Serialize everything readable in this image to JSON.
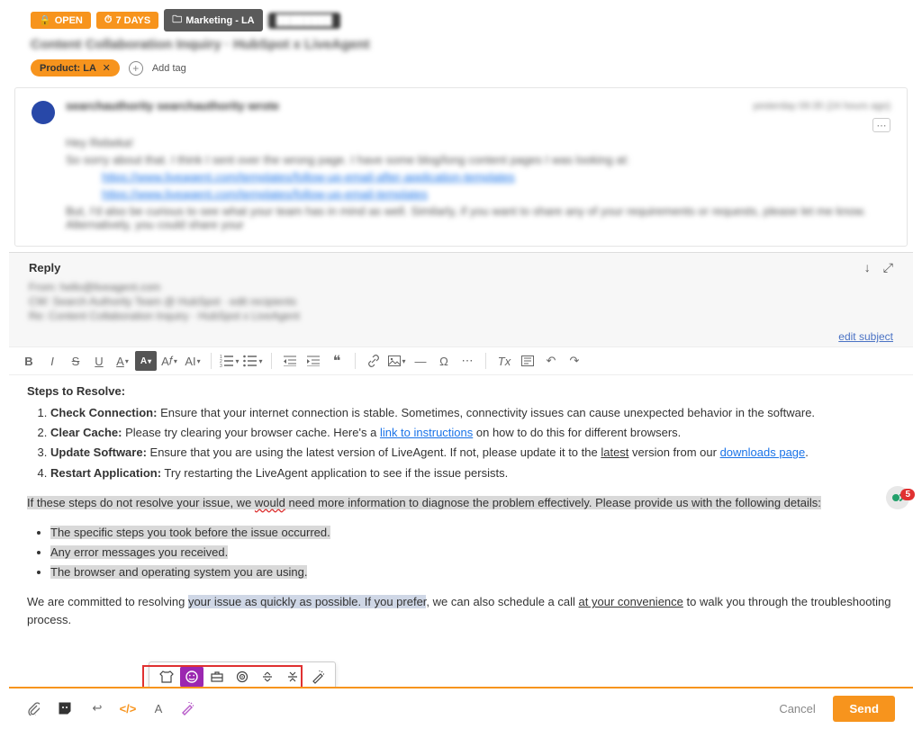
{
  "badges": {
    "open_icon": "lock",
    "open": "OPEN",
    "days_icon": "clock",
    "days": "7 DAYS",
    "folder_icon": "folder",
    "folder": "Marketing - LA",
    "hidden": "████████"
  },
  "ticket": {
    "subject_blur": "Content Collaboration Inquiry · HubSpot x LiveAgent",
    "tag_chip": "Product: LA",
    "tag_chip_remove": "✕",
    "add_tag": "Add tag"
  },
  "message": {
    "sender_blur": "searchauthority searchauthority wrote",
    "time_blur": "yesterday 09:35 (24 hours ago)",
    "greeting_blur": "Hey Rebeka!",
    "line1_blur": "So sorry about that. I think I sent over the wrong page. I have some blog/long content pages I was looking at:",
    "link1_blur": "https://www.liveagent.com/templates/follow-up-email-after-application-templates",
    "link2_blur": "https://www.liveagent.com/templates/follow-up-email-templates",
    "line2_blur": "But, I'd also be curious to see what your team has in mind as well. Similarly, if you want to share any of your requirements or requests, please let me know. Alternatively, you could share your"
  },
  "reply": {
    "title": "Reply",
    "from_blur": "From: hello@liveagent.com",
    "to_blur": "CW: Search Authority Team @ HubSpot · edit recipients",
    "subj_blur": "Re: Content Collaboration Inquiry · HubSpot x LiveAgent",
    "edit_subject": "edit subject"
  },
  "toolbar": {
    "bold": "B",
    "italic": "I",
    "strike": "S",
    "underline": "U",
    "a_caret": "A",
    "fill": "A",
    "font": "A",
    "size": "AI",
    "ol": "ol",
    "ul": "ul",
    "outdent": "⇤",
    "indent": "⇥",
    "quote": "❝",
    "link": "link",
    "image": "img",
    "hr": "—",
    "omega": "Ω",
    "more": "⋯",
    "tx": "Tx",
    "box": "☐",
    "undo": "↶",
    "redo": "↷"
  },
  "body": {
    "heading": "Steps to Resolve:",
    "s1a": "Check Connection:",
    "s1b": " Ensure that your internet connection is stable. Sometimes, connectivity issues can cause unexpected behavior in the software.",
    "s2a": "Clear Cache:",
    "s2b": " Please try clearing your browser cache. Here's a ",
    "s2link": "link to instructions",
    "s2c": " on how to do this for different browsers.",
    "s3a": "Update Software:",
    "s3b": " Ensure that you are using the latest version of LiveAgent. If not, please update it to the ",
    "s3u": "latest",
    "s3c": " version from our ",
    "s3link": "downloads page",
    "s3d": ".",
    "s4a": "Restart Application:",
    "s4b": " Try restarting the LiveAgent application to see if the issue persists.",
    "para1a": "If these steps do not resolve your issue, we ",
    "para1err": "would",
    "para1b": " need more information to diagnose the problem effectively. Please provide us with the following details:",
    "b1": "The specific steps you took before the issue occurred.",
    "b2": "Any error messages you received.",
    "b3": "The browser and operating system you are using.",
    "para2a": "We are committed to resolving ",
    "para2sel": "your issue as quickly as possible. If you prefer",
    "para2b": ", we can also schedule a call ",
    "para2u": "at your convenience",
    "para2c": " to walk you through the troubleshooting process."
  },
  "ai_popup": {
    "i1": "shirt",
    "i2": "smile",
    "i3": "briefcase",
    "i4": "target",
    "i5": "expand",
    "i6": "collapse",
    "i7": "wand"
  },
  "bottom_icons": {
    "attach": "paperclip",
    "note": "note",
    "reply": "reply-arrow",
    "code": "code",
    "a": "A",
    "wand": "wand"
  },
  "actions": {
    "cancel": "Cancel",
    "send": "Send"
  },
  "float": {
    "count": "5"
  }
}
